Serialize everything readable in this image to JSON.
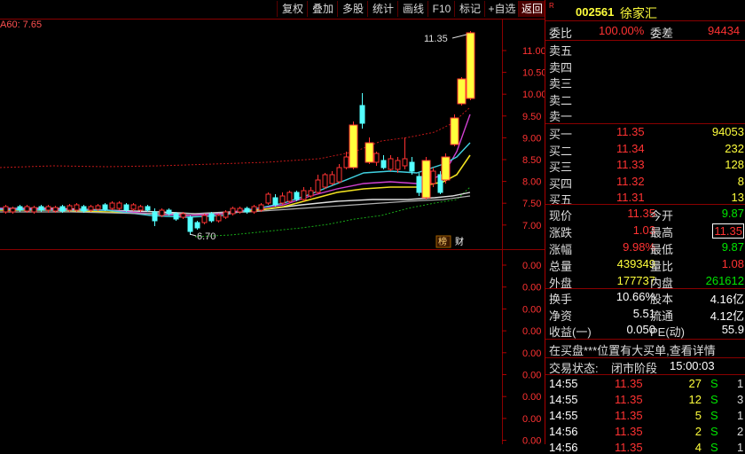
{
  "toolbar": {
    "buttons": [
      "复权",
      "叠加",
      "多股",
      "统计",
      "画线",
      "F10",
      "标记",
      "+自选",
      "返回"
    ]
  },
  "ma_label": "A60: 7.65",
  "chart": {
    "y_ticks": [
      "11.00",
      "10.50",
      "10.00",
      "9.50",
      "9.00",
      "8.50",
      "8.00",
      "7.50",
      "7.00"
    ],
    "high_label": "11.35",
    "low_label": "6.70",
    "badge1": "榜",
    "badge2": "财",
    "sub_ticks": [
      "0.00",
      "0.00",
      "0.00",
      "0.00",
      "0.00",
      "0.00",
      "0.00",
      "0.00",
      "0.00"
    ]
  },
  "chart_data": {
    "type": "candlestick",
    "last_close": 11.35,
    "period_high": 11.35,
    "period_low": 6.7,
    "ylim": [
      6.6,
      11.6
    ]
  },
  "quote": {
    "code_prefix": "R",
    "code": "002561",
    "name": "徐家汇",
    "weibi_label": "委比",
    "weibi_value": "100.00%",
    "weicha_label": "委差",
    "weicha_value": "94434",
    "sell": [
      "卖五",
      "卖四",
      "卖三",
      "卖二",
      "卖一"
    ],
    "buy": [
      {
        "label": "买一",
        "price": "11.35",
        "vol": "94053"
      },
      {
        "label": "买二",
        "price": "11.34",
        "vol": "232"
      },
      {
        "label": "买三",
        "price": "11.33",
        "vol": "128"
      },
      {
        "label": "买四",
        "price": "11.32",
        "vol": "8"
      },
      {
        "label": "买五",
        "price": "11.31",
        "vol": "13"
      }
    ],
    "stats": [
      {
        "l1": "现价",
        "v1": "11.35",
        "l2": "今开",
        "v2": "9.87"
      },
      {
        "l1": "涨跌",
        "v1": "1.03",
        "l2": "最高",
        "v2": "11.35"
      },
      {
        "l1": "涨幅",
        "v1": "9.98%",
        "l2": "最低",
        "v2": "9.87"
      },
      {
        "l1": "总量",
        "v1": "439349",
        "l2": "量比",
        "v2": "1.08"
      },
      {
        "l1": "外盘",
        "v1": "177737",
        "l2": "内盘",
        "v2": "261612"
      }
    ],
    "stats2": [
      {
        "l1": "换手",
        "v1": "10.66%",
        "l2": "股本",
        "v2": "4.16亿"
      },
      {
        "l1": "净资",
        "v1": "5.51",
        "l2": "流通",
        "v2": "4.12亿"
      },
      {
        "l1": "收益(一)",
        "v1": "0.050",
        "l2": "PE(动)",
        "v2": "55.9"
      }
    ],
    "notice": "在买盘***位置有大买单,查看详情",
    "status_label": "交易状态:",
    "status_value": "闭市阶段",
    "status_time": "15:00:03",
    "ticks": [
      {
        "time": "14:55",
        "price": "11.35",
        "vol": "27",
        "side": "S",
        "extra": "1"
      },
      {
        "time": "14:55",
        "price": "11.35",
        "vol": "12",
        "side": "S",
        "extra": "3"
      },
      {
        "time": "14:55",
        "price": "11.35",
        "vol": "5",
        "side": "S",
        "extra": "1"
      },
      {
        "time": "14:56",
        "price": "11.35",
        "vol": "2",
        "side": "S",
        "extra": "2"
      },
      {
        "time": "14:56",
        "price": "11.35",
        "vol": "4",
        "side": "S",
        "extra": "1"
      }
    ]
  }
}
